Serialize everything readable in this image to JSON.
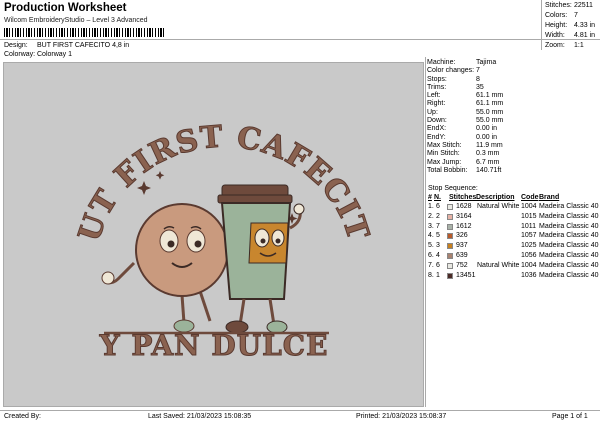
{
  "header": {
    "title": "Production Worksheet",
    "subtitle": "Wilcom EmbroideryStudio – Level 3 Advanced",
    "design_label": "Design:",
    "design_value": "BUT FIRST CAFECITO 4,8 in",
    "colorway_label": "Colorway:",
    "colorway_value": "Colorway 1"
  },
  "stats": [
    {
      "label": "Stitches:",
      "value": "22511"
    },
    {
      "label": "Colors:",
      "value": "7"
    },
    {
      "label": "Height:",
      "value": "4.33 in"
    },
    {
      "label": "Width:",
      "value": "4.81 in"
    },
    {
      "label": "Zoom:",
      "value": "1:1"
    }
  ],
  "design": {
    "top_text": "BUT FIRST CAFECITO",
    "bottom_text": "Y PAN DULCE",
    "colors": {
      "background": "#c9c9c9",
      "brown_dark": "#6e4a3c",
      "brown_mid": "#8a6250",
      "tan": "#c99a7e",
      "orange": "#c8862e",
      "sage": "#9bb39a",
      "cream": "#efe7d6",
      "outline": "#3b2a25"
    }
  },
  "machine_info": [
    {
      "label": "Machine:",
      "value": "Tajima"
    },
    {
      "label": "Color changes:",
      "value": "7"
    },
    {
      "label": "Stops:",
      "value": "8"
    },
    {
      "label": "Trims:",
      "value": "35"
    },
    {
      "label": "Left:",
      "value": "61.1 mm"
    },
    {
      "label": "Right:",
      "value": "61.1 mm"
    },
    {
      "label": "Up:",
      "value": "55.0 mm"
    },
    {
      "label": "Down:",
      "value": "55.0 mm"
    },
    {
      "label": "EndX:",
      "value": "0.00 in"
    },
    {
      "label": "EndY:",
      "value": "0.00 in"
    },
    {
      "label": "Max Stitch:",
      "value": "11.9 mm"
    },
    {
      "label": "Min Stitch:",
      "value": "0.3 mm"
    },
    {
      "label": "Max Jump:",
      "value": "6.7 mm"
    },
    {
      "label": "Total Bobbin:",
      "value": "140.71ft"
    }
  ],
  "sequence": {
    "title": "Stop Sequence:",
    "headers": {
      "num": "#",
      "n": "N.",
      "stitches": "Stitches",
      "description": "Description",
      "code": "Code",
      "brand": "Brand"
    },
    "rows": [
      {
        "num": "1.",
        "n": "6",
        "color": "#e8e8e2",
        "stitches": "1628",
        "description": "Natural White",
        "code": "1004",
        "brand": "Madeira Classic 40"
      },
      {
        "num": "2.",
        "n": "2",
        "color": "#e6b2a6",
        "stitches": "3164",
        "description": "",
        "code": "1015",
        "brand": "Madeira Classic 40"
      },
      {
        "num": "3.",
        "n": "7",
        "color": "#a9b2a8",
        "stitches": "1612",
        "description": "",
        "code": "1011",
        "brand": "Madeira Classic 40"
      },
      {
        "num": "4.",
        "n": "5",
        "color": "#b85a2a",
        "stitches": "326",
        "description": "",
        "code": "1057",
        "brand": "Madeira Classic 40"
      },
      {
        "num": "5.",
        "n": "3",
        "color": "#c7801f",
        "stitches": "937",
        "description": "",
        "code": "1025",
        "brand": "Madeira Classic 40"
      },
      {
        "num": "6.",
        "n": "4",
        "color": "#a88270",
        "stitches": "639",
        "description": "",
        "code": "1056",
        "brand": "Madeira Classic 40"
      },
      {
        "num": "7.",
        "n": "6",
        "color": "#e8e8e2",
        "stitches": "752",
        "description": "Natural White",
        "code": "1004",
        "brand": "Madeira Classic 40"
      },
      {
        "num": "8.",
        "n": "1",
        "color": "#4a2a26",
        "stitches": "13451",
        "description": "",
        "code": "1036",
        "brand": "Madeira Classic 40"
      }
    ]
  },
  "footer": {
    "created_by": "Created By:",
    "last_saved": "Last Saved: 21/03/2023 15:08:35",
    "printed": "Printed: 21/03/2023 15:08:37",
    "page": "Page 1 of 1"
  }
}
